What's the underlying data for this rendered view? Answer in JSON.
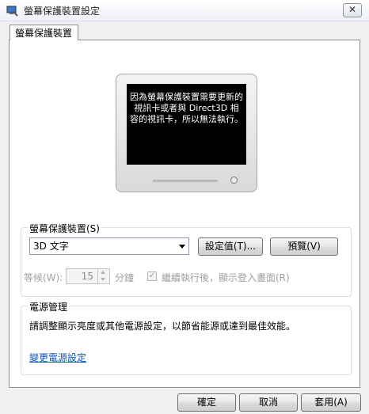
{
  "window": {
    "title": "螢幕保護裝置設定",
    "close_label": "✕"
  },
  "tab": {
    "label": "螢幕保護裝置"
  },
  "preview": {
    "message": "因為螢幕保護裝置需要更新的視訊卡或者與 Direct3D 相容的視訊卡，所以無法執行。"
  },
  "screensaver": {
    "group_label": "螢幕保護裝置(S)",
    "selected": "3D 文字",
    "settings_label": "設定值(T)...",
    "preview_label": "預覽(V)",
    "wait_label": "等候(W):",
    "wait_value": "15",
    "wait_unit": "分鐘",
    "resume_label": "繼續執行後，顯示登入畫面(R)",
    "resume_checked": true
  },
  "power": {
    "group_label": "電源管理",
    "description": "請調整顯示亮度或其他電源設定，以節省能源或達到最佳效能。",
    "link_label": "變更電源設定"
  },
  "footer": {
    "ok_label": "確定",
    "cancel_label": "取消",
    "apply_label": "套用(A)"
  },
  "colors": {
    "link": "#0d55b8",
    "screen_bg": "#000000"
  },
  "icons": {
    "app": "screensaver-settings-icon",
    "close": "close-icon",
    "dropdown": "chevron-down-icon",
    "check": "checkmark-icon"
  }
}
